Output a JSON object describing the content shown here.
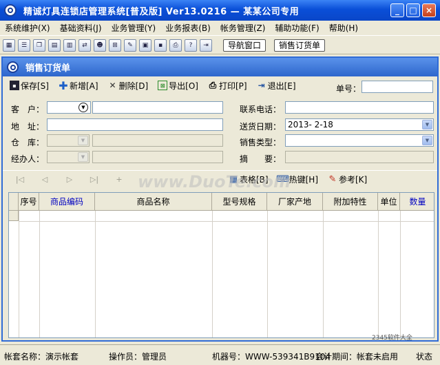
{
  "window": {
    "title": "精诚灯具连锁店管理系统[普及版] Ver13.0216 — 某某公司专用",
    "min": "_",
    "max": "□",
    "close": "×"
  },
  "menu": [
    "系统维护(X)",
    "基础资料(J)",
    "业务管理(Y)",
    "业务报表(B)",
    "帐务管理(Z)",
    "辅助功能(F)",
    "帮助(H)"
  ],
  "toolbar": {
    "nav_window": "导航窗口",
    "sales_order": "销售订货单"
  },
  "child": {
    "title": "销售订货单"
  },
  "actions": {
    "save": "保存[S]",
    "add": "新增[A]",
    "delete": "删除[D]",
    "export": "导出[O]",
    "print": "打印[P]",
    "exit": "退出[E]",
    "order_no_label": "单号："
  },
  "form": {
    "customer_label": "客　户：",
    "address_label": "地　址：",
    "warehouse_label": "仓　库：",
    "handler_label": "经办人：",
    "phone_label": "联系电话：",
    "delivery_date_label": "送货日期：",
    "delivery_date_value": "2013- 2-18",
    "sales_type_label": "销售类型：",
    "summary_label": "摘　　要："
  },
  "nav": {
    "first": "|◁",
    "prev": "◁",
    "next": "▷",
    "last": "▷|",
    "add": "+",
    "grid_setting": "表格[B]",
    "hotkey": "热键[H]",
    "reference": "参考[K]"
  },
  "grid": {
    "columns": [
      "序号",
      "商品编码",
      "商品名称",
      "型号规格",
      "厂家产地",
      "附加特性",
      "单位",
      "数量"
    ]
  },
  "status": {
    "account": "帐套名称：演示帐套",
    "operator": "操作员：管理员",
    "machine": "机器号：WWW-539341B9104",
    "period": "会计期间：帐套未启用",
    "state": "状态"
  },
  "watermark": {
    "main": "www.DuoTe.com",
    "corner": "2345软件大全"
  }
}
